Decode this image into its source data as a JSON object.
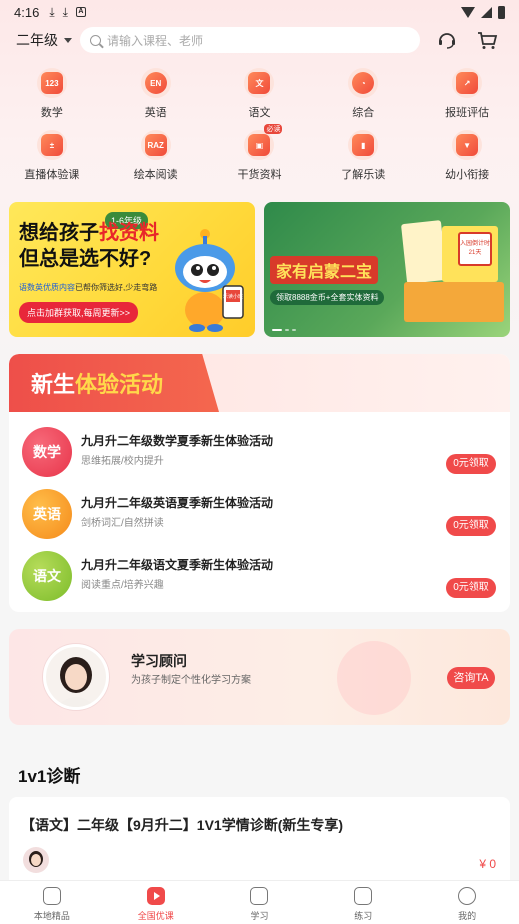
{
  "status_bar": {
    "time": "4:16"
  },
  "header": {
    "grade": "二年级",
    "search_placeholder": "请输入课程、老师"
  },
  "grid": [
    {
      "label": "数学",
      "icon": "math-123-icon",
      "glyph": "123"
    },
    {
      "label": "英语",
      "icon": "english-en-icon",
      "glyph": "EN"
    },
    {
      "label": "语文",
      "icon": "chinese-wen-icon",
      "glyph": "文"
    },
    {
      "label": "综合",
      "icon": "pie-chart-icon",
      "glyph": "◔"
    },
    {
      "label": "报班评估",
      "icon": "arrow-card-icon",
      "glyph": "↗"
    },
    {
      "label": "直播体验课",
      "icon": "calculator-icon",
      "glyph": "±"
    },
    {
      "label": "绘本阅读",
      "icon": "raz-book-icon",
      "glyph": "RAZ"
    },
    {
      "label": "干货资料",
      "icon": "gift-box-icon",
      "glyph": "▣",
      "badge": "必读"
    },
    {
      "label": "了解乐读",
      "icon": "thumb-icon",
      "glyph": "▮"
    },
    {
      "label": "幼小衔接",
      "icon": "banner-flag-icon",
      "glyph": "▼"
    }
  ],
  "banner1": {
    "grade_tag": "1-6年级",
    "line1_a": "想给孩子",
    "line1_b": "找资料",
    "line2": "但总是选不好?",
    "sub_a": "语数英优质内容",
    "sub_b": "已帮你筛选好,少走弯路",
    "button": "点击加群获取,每周更新>>",
    "robot_sign": "乐读小班"
  },
  "banner2": {
    "title": "家有启蒙二宝",
    "sub": "领取8888金币+全套实体资料",
    "tag": "入园倒计时21天"
  },
  "activity": {
    "title_a": "新生",
    "title_b": "体验活动",
    "items": [
      {
        "subject": "数学",
        "title": "九月升二年级数学夏季新生体验活动",
        "sub": "思维拓展/校内提升",
        "button": "0元领取",
        "color_a": "#f05a6a",
        "color_b": "#e8344a"
      },
      {
        "subject": "英语",
        "title": "九月升二年级英语夏季新生体验活动",
        "sub": "剑桥词汇/自然拼读",
        "button": "0元领取",
        "color_a": "#ffb03a",
        "color_b": "#f58a1a"
      },
      {
        "subject": "语文",
        "title": "九月升二年级语文夏季新生体验活动",
        "sub": "阅读重点/培养兴趣",
        "button": "0元领取",
        "color_a": "#a6d44a",
        "color_b": "#7cbc2a"
      }
    ]
  },
  "advisor": {
    "title": "学习顾问",
    "sub": "为孩子制定个性化学习方案",
    "button": "咨询TA"
  },
  "diagnosis": {
    "section_title": "1v1诊断",
    "course_name": "【语文】二年级【9月升二】1V1学情诊断(新生专享)",
    "price": "¥ 0"
  },
  "tabbar": [
    {
      "label": "本地精品",
      "icon": "home-icon",
      "active": false
    },
    {
      "label": "全国优课",
      "icon": "play-icon",
      "active": true
    },
    {
      "label": "学习",
      "icon": "book-icon",
      "active": false
    },
    {
      "label": "练习",
      "icon": "folder-icon",
      "active": false
    },
    {
      "label": "我的",
      "icon": "profile-icon",
      "active": false
    }
  ]
}
